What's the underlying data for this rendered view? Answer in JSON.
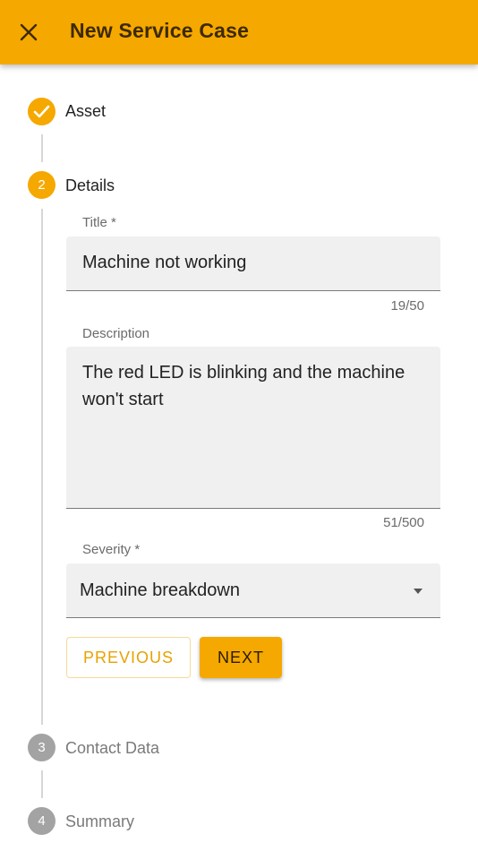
{
  "appbar": {
    "title": "New Service Case",
    "close_icon": "close-icon"
  },
  "colors": {
    "accent": "#f5a800",
    "inactive_step": "#a3a3a3"
  },
  "steps": [
    {
      "label": "Asset",
      "marker": "check-icon",
      "state": "completed"
    },
    {
      "label": "Details",
      "number": "2",
      "state": "active"
    },
    {
      "label": "Contact Data",
      "number": "3",
      "state": "inactive"
    },
    {
      "label": "Summary",
      "number": "4",
      "state": "inactive"
    }
  ],
  "form": {
    "title": {
      "label": "Title *",
      "value": "Machine not working",
      "counter": "19/50"
    },
    "description": {
      "label": "Description",
      "value": "The red LED is blinking and the machine won't start",
      "counter": "51/500"
    },
    "severity": {
      "label": "Severity *",
      "value": "Machine breakdown",
      "caret_icon": "caret-down-icon"
    }
  },
  "buttons": {
    "previous": "PREVIOUS",
    "next": "NEXT"
  }
}
